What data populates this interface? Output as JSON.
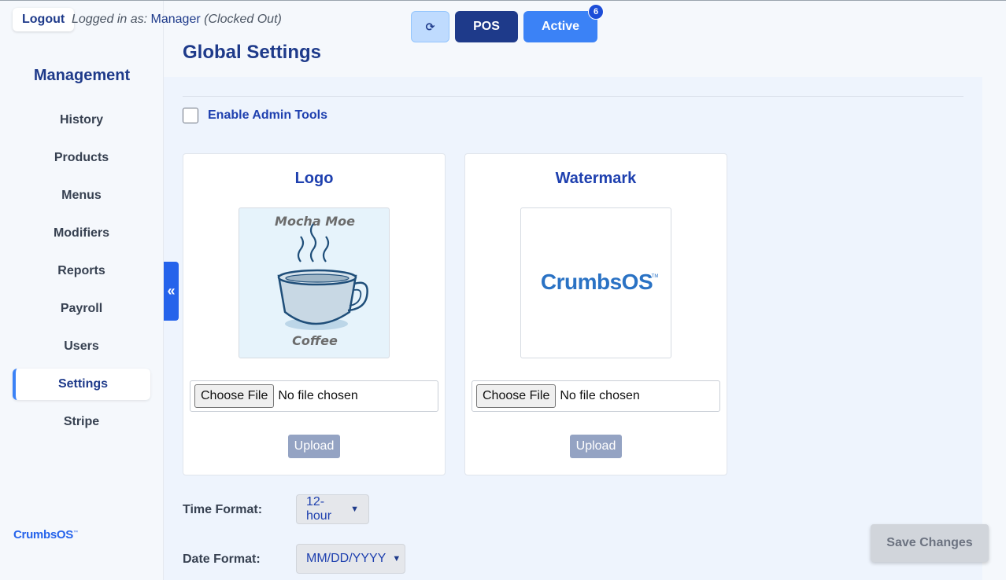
{
  "header": {
    "logout_label": "Logout",
    "logged_in_prefix": "Logged in as:",
    "user_name": "Manager",
    "clock_status": "(Clocked Out)",
    "refresh_icon": "⟳",
    "pos_label": "POS",
    "active_label": "Active",
    "active_badge_count": "6"
  },
  "sidebar": {
    "title": "Management",
    "items": [
      {
        "label": "History"
      },
      {
        "label": "Products"
      },
      {
        "label": "Menus"
      },
      {
        "label": "Modifiers"
      },
      {
        "label": "Reports"
      },
      {
        "label": "Payroll"
      },
      {
        "label": "Users"
      },
      {
        "label": "Settings",
        "active": true
      },
      {
        "label": "Stripe"
      }
    ],
    "brand_logo_text": "CrumbsOS",
    "brand_logo_tm": "™",
    "collapse_icon": "«"
  },
  "main": {
    "title": "Global Settings",
    "admin_tools_label": "Enable Admin Tools",
    "admin_tools_checked": false,
    "logo_card": {
      "title": "Logo",
      "image_top_text": "Mocha Moe",
      "image_bottom_text": "Coffee",
      "choose_file_label": "Choose File",
      "no_file_text": "No file chosen",
      "upload_label": "Upload"
    },
    "watermark_card": {
      "title": "Watermark",
      "image_text": "CrumbsOS",
      "image_tm": "TM",
      "choose_file_label": "Choose File",
      "no_file_text": "No file chosen",
      "upload_label": "Upload"
    },
    "time_format": {
      "label": "Time Format:",
      "value": "12-hour"
    },
    "date_format": {
      "label": "Date Format:",
      "value": "MM/DD/YYYY"
    },
    "save_label": "Save Changes"
  },
  "colors": {
    "primary": "#1e3a8a",
    "accent": "#3b82f6",
    "background": "#f5f8fc",
    "panel": "#eef4fd"
  }
}
